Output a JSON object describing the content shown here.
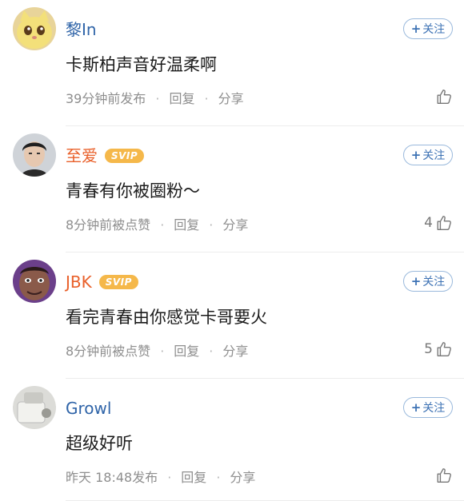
{
  "follow_label": "关注",
  "comments": [
    {
      "username": "黎In",
      "username_color": "#2f64a8",
      "svip": "",
      "text": "卡斯柏声音好温柔啊",
      "time": "39分钟前发布",
      "reply": "回复",
      "share": "分享",
      "likes": "",
      "avatar_icon": "cat-avatar"
    },
    {
      "username": "至爱",
      "username_color": "#e9602a",
      "svip": "SVIP",
      "text": "青春有你被圈粉～",
      "time": "8分钟前被点赞",
      "reply": "回复",
      "share": "分享",
      "likes": "4",
      "avatar_icon": "person-avatar"
    },
    {
      "username": "JBK",
      "username_color": "#e9602a",
      "svip": "SVIP",
      "text": "看完青春由你感觉卡哥要火",
      "time": "8分钟前被点赞",
      "reply": "回复",
      "share": "分享",
      "likes": "5",
      "avatar_icon": "face-avatar"
    },
    {
      "username": "Growl",
      "username_color": "#2f64a8",
      "svip": "",
      "text": "超级好听",
      "time": "昨天 18:48发布",
      "reply": "回复",
      "share": "分享",
      "likes": "",
      "avatar_icon": "object-avatar"
    }
  ]
}
